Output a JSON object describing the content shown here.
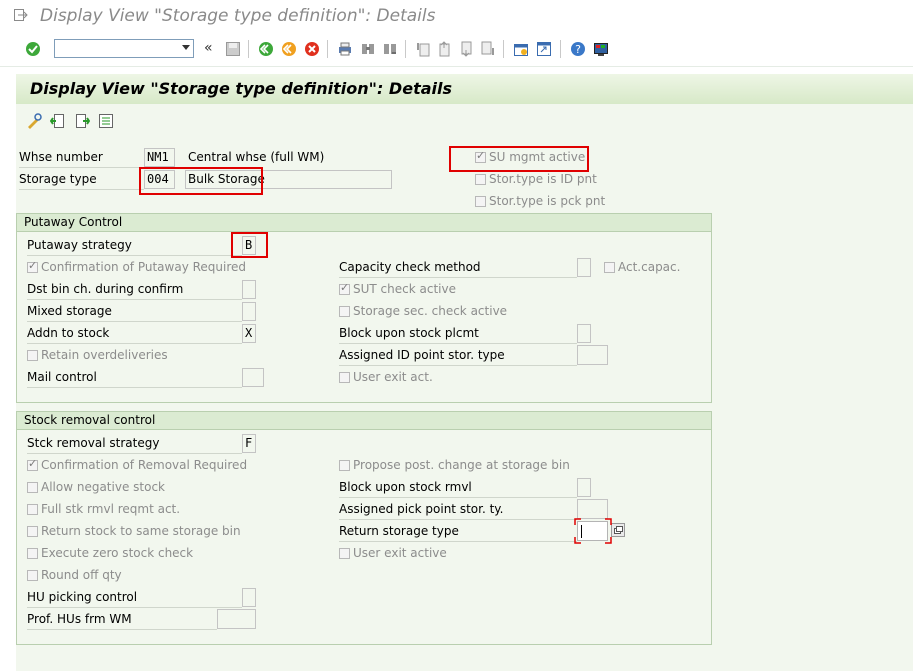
{
  "window": {
    "title": "Display View \"Storage type definition\": Details"
  },
  "toolbar": {
    "command_value": "",
    "icons": [
      "enter-icon",
      "back-icon",
      "save-icon",
      "back-nav-icon",
      "exit-icon",
      "cancel-icon",
      "print-icon",
      "find-icon",
      "find-next-icon",
      "first-page-icon",
      "prev-page-icon",
      "next-page-icon",
      "last-page-icon",
      "new-session-icon",
      "shortcut-icon",
      "help-icon",
      "customize-icon"
    ]
  },
  "header": {
    "title": "Display View \"Storage type definition\": Details"
  },
  "app_toolbar": {
    "icons": [
      "display-change-icon",
      "prev-entry-icon",
      "next-entry-icon",
      "variable-list-icon"
    ]
  },
  "top": {
    "whse_label": "Whse number",
    "whse_value": "NM1",
    "whse_desc": "Central whse (full WM)",
    "stortype_label": "Storage type",
    "stortype_value": "004",
    "stortype_desc": "Bulk Storage",
    "su_mgmt": "SU mgmt active",
    "stor_id": "Stor.type is ID pnt",
    "stor_pck": "Stor.type is pck pnt"
  },
  "putaway": {
    "title": "Putaway Control",
    "strategy_label": "Putaway strategy",
    "strategy_value": "B",
    "confirm": "Confirmation of Putaway Required",
    "dst_bin": "Dst bin ch. during confirm",
    "mixed": "Mixed storage",
    "addn": "Addn to stock",
    "addn_value": "X",
    "retain": "Retain overdeliveries",
    "mail": "Mail control",
    "capacity": "Capacity check method",
    "act_capac": "Act.capac.",
    "sut_check": "SUT check active",
    "storage_sec": "Storage sec. check active",
    "block_plcmt": "Block upon stock plcmt",
    "assigned_id": "Assigned ID point stor. type",
    "user_exit": "User exit act."
  },
  "removal": {
    "title": "Stock removal control",
    "strategy_label": "Stck removal strategy",
    "strategy_value": "F",
    "confirm": "Confirmation of Removal Required",
    "negative": "Allow negative stock",
    "full_stk": "Full stk rmvl reqmt act.",
    "return_same": "Return stock to same storage bin",
    "zero_check": "Execute zero stock check",
    "round_off": "Round off qty",
    "hu_picking": "HU picking control",
    "prof_hus": "Prof. HUs frm WM",
    "propose": "Propose post. change at storage bin",
    "block_rmvl": "Block upon stock rmvl",
    "assigned_pick": "Assigned pick point stor. ty.",
    "return_type": "Return storage type",
    "user_exit": "User exit active"
  },
  "colors": {
    "header_green": "#d7e9c8",
    "panel_bg": "#f2f7ee",
    "highlight_red": "#e00000"
  }
}
